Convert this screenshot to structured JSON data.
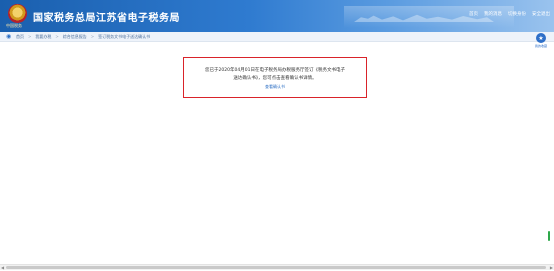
{
  "header": {
    "emblem_text": "中国税务",
    "title": "国家税务总局江苏省电子税务局",
    "nav": [
      "首页",
      "我的消息",
      "切换身份",
      "安全退出"
    ]
  },
  "breadcrumb": [
    "首页",
    "我要办税",
    "综合信息报告",
    "签订税务文书电子送达确认书"
  ],
  "side_button_label": "我的收藏",
  "notice": {
    "line1": "您已于2020年04月01日在电子税务局办税服务厅签订《税务文书电子",
    "line2": "送达确认书》，您可点击查看确认书详情。",
    "link": "查看确认书"
  },
  "colors": {
    "header_blue": "#1a5fae",
    "notice_border": "#d9232a",
    "link": "#2d6fc4"
  }
}
